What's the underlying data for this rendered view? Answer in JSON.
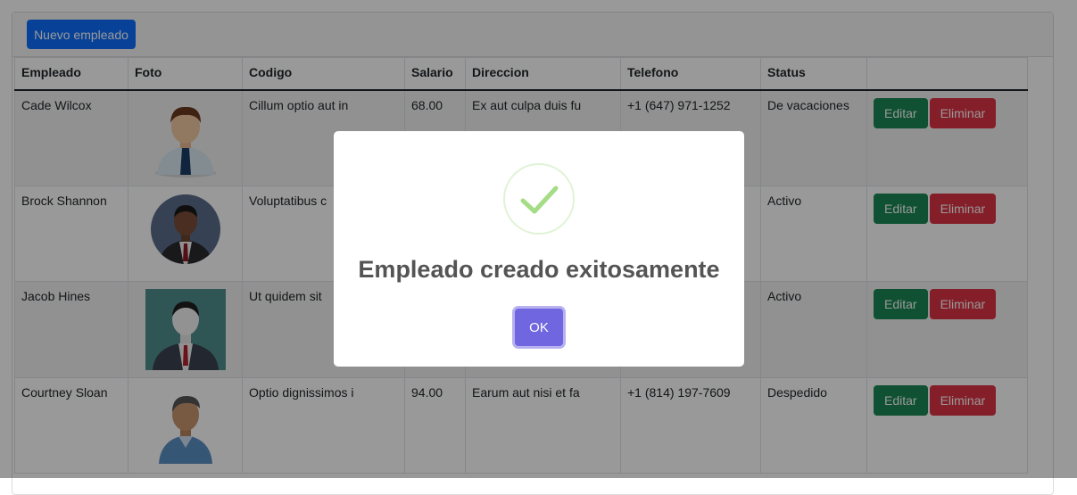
{
  "toolbar": {
    "new_employee_label": "Nuevo empleado"
  },
  "table": {
    "headers": [
      "Empleado",
      "Foto",
      "Codigo",
      "Salario",
      "Direccion",
      "Telefono",
      "Status",
      ""
    ],
    "rows": [
      {
        "empleado": "Cade Wilcox",
        "foto": "avatar-man-shirt-tie-icon",
        "codigo": "Cillum optio aut in",
        "salario": "68.00",
        "direccion": "Ex aut culpa duis fu",
        "telefono": "+1 (647) 971-1252",
        "status": "De vacaciones",
        "edit": "Editar",
        "delete": "Eliminar"
      },
      {
        "empleado": "Brock Shannon",
        "foto": "avatar-man-suit-circle-icon",
        "codigo": "Voluptatibus c",
        "salario": "",
        "direccion": "",
        "telefono": "",
        "status": "Activo",
        "edit": "Editar",
        "delete": "Eliminar"
      },
      {
        "empleado": "Jacob Hines",
        "foto": "avatar-man-suit-square-icon",
        "codigo": "Ut quidem sit",
        "salario": "",
        "direccion": "",
        "telefono": "",
        "status": "Activo",
        "edit": "Editar",
        "delete": "Eliminar"
      },
      {
        "empleado": "Courtney Sloan",
        "foto": "avatar-man-casual-icon",
        "codigo": "Optio dignissimos i",
        "salario": "94.00",
        "direccion": "Earum aut nisi et fa",
        "telefono": "+1 (814) 197-7609",
        "status": "Despedido",
        "edit": "Editar",
        "delete": "Eliminar"
      }
    ]
  },
  "modal": {
    "icon": "success-checkmark-icon",
    "title": "Empleado creado exitosamente",
    "confirm_label": "OK"
  },
  "colors": {
    "primary": "#0d6efd",
    "success": "#198754",
    "danger": "#dc3545",
    "confirm": "#7066e0",
    "check": "#a5dc86"
  }
}
